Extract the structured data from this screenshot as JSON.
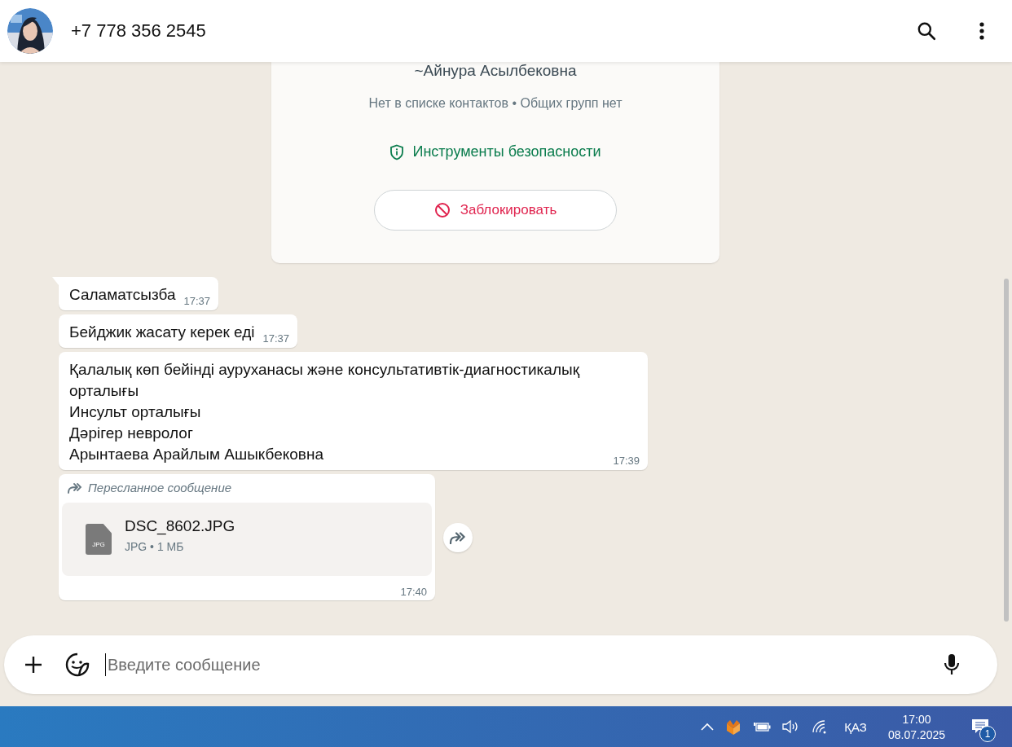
{
  "header": {
    "title": "+7 778 356 2545"
  },
  "contact_card": {
    "name": "~Айнура Асылбековна",
    "subtitle": "Нет в списке контактов • Общих групп нет",
    "safety_link": "Инструменты безопасности",
    "block_button": "Заблокировать"
  },
  "messages": [
    {
      "kind": "text",
      "lines": [
        "Саламатсызба"
      ],
      "time": "17:37",
      "tail": true
    },
    {
      "kind": "text",
      "lines": [
        "Бейджик жасату керек еді"
      ],
      "time": "17:37",
      "tail": false
    },
    {
      "kind": "text",
      "lines": [
        "Қалалық көп бейінді ауруханасы және консультативтік-диагностикалық орталығы",
        "Инсульт орталығы",
        "Дәрігер невролог",
        "Арынтаева Арайлым Ашыкбековна"
      ],
      "time": "17:39",
      "tail": false
    },
    {
      "kind": "file",
      "forwarded": true,
      "forwarded_label": "Пересланное сообщение",
      "file_name": "DSC_8602.JPG",
      "file_badge": "JPG",
      "file_meta": "JPG • 1 МБ",
      "time": "17:40",
      "tail": false
    }
  ],
  "composer": {
    "placeholder": "Введите сообщение"
  },
  "taskbar": {
    "language": "ҚАЗ",
    "time": "17:00",
    "date": "08.07.2025",
    "notification_count": "1"
  }
}
